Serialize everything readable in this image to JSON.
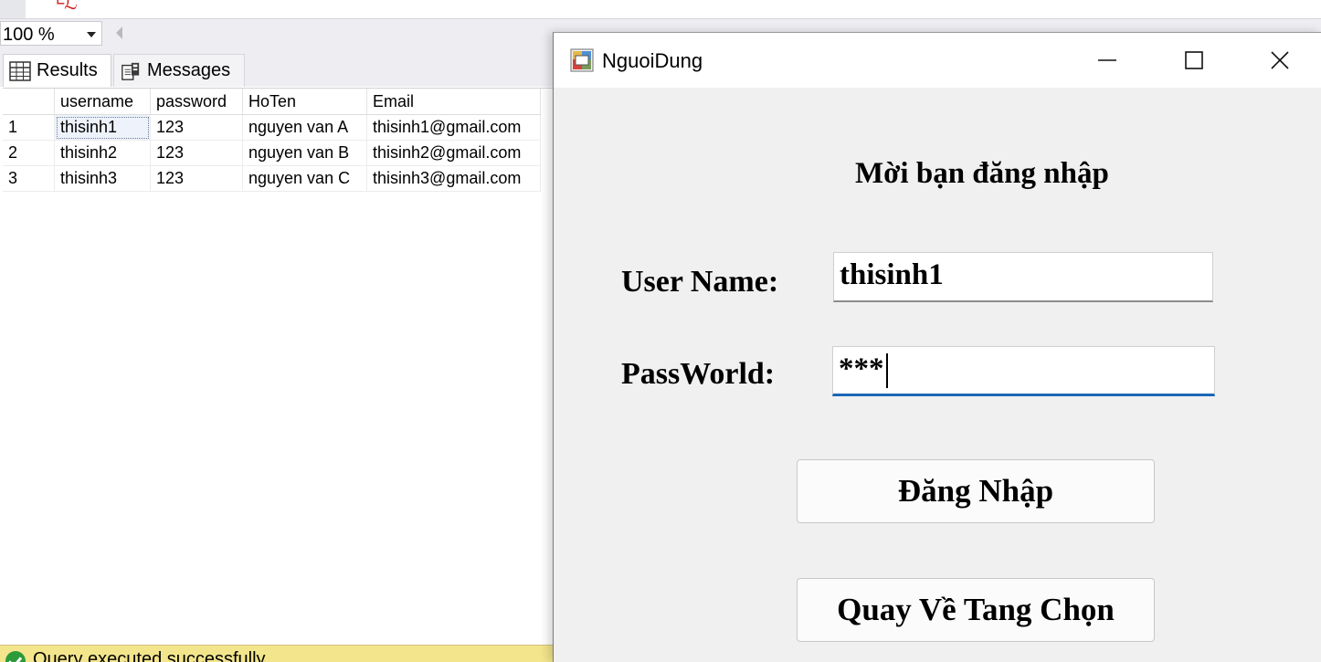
{
  "ssms": {
    "editor_glyph": "└ℒ",
    "zoom_value": "100 %",
    "tabs": {
      "results": "Results",
      "messages": "Messages"
    },
    "grid": {
      "columns": [
        "",
        "username",
        "password",
        "HoTen",
        "Email"
      ],
      "rows": [
        [
          "1",
          "thisinh1",
          "123",
          "nguyen van A",
          "thisinh1@gmail.com"
        ],
        [
          "2",
          "thisinh2",
          "123",
          "nguyen van B",
          "thisinh2@gmail.com"
        ],
        [
          "3",
          "thisinh3",
          "123",
          "nguyen van C",
          "thisinh3@gmail.com"
        ]
      ],
      "selected_cell": {
        "row": 0,
        "col": 1
      }
    },
    "status_text": "Query executed successfully."
  },
  "dialog": {
    "title": "NguoiDung",
    "heading": "Mời bạn đăng nhập",
    "username_label": "User Name:",
    "password_label": "PassWorld:",
    "username_value": "thisinh1",
    "password_value": "***",
    "login_button": "Đăng Nhập",
    "back_button": "Quay Về Tang Chọn"
  },
  "colors": {
    "focus_underline": "#1a66b8",
    "status_bar": "#f3e58c",
    "success_icon": "#2d9a3a"
  },
  "icons": {
    "results_tab": "grid-icon",
    "messages_tab": "messages-icon",
    "app": "winforms-app-icon",
    "window": [
      "minimize-icon",
      "maximize-icon",
      "close-icon"
    ],
    "status": "success-check-icon"
  }
}
